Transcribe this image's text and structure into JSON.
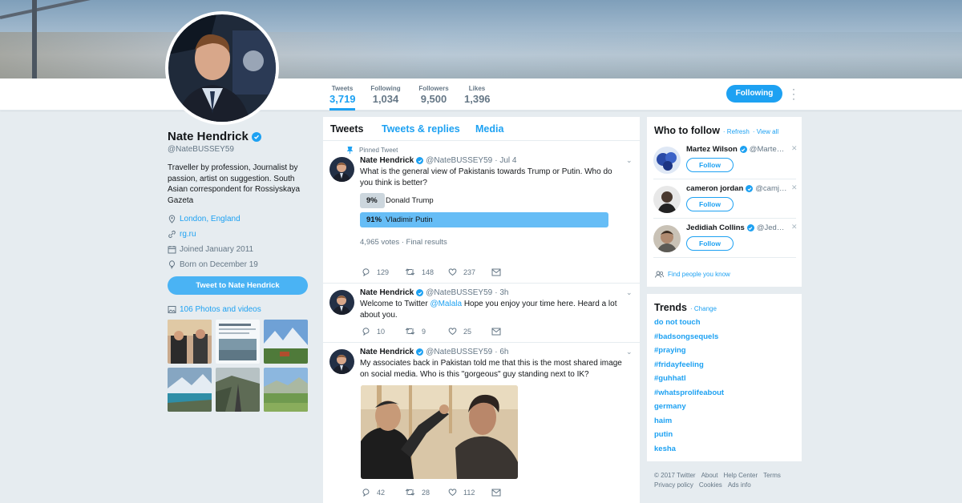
{
  "profile": {
    "name": "Nate Hendrick",
    "handle": "@NateBUSSEY59",
    "bio": "Traveller by profession, Journalist by passion, artist on suggestion. South Asian correspondent for Rossiyskaya Gazeta",
    "location": "London, England",
    "website": "rg.ru",
    "joined": "Joined January 2011",
    "born": "Born on December 19",
    "tweet_to_label": "Tweet to Nate Hendrick",
    "photos_label": "106 Photos and videos"
  },
  "stats": {
    "tweets_label": "Tweets",
    "tweets_value": "3,719",
    "following_label": "Following",
    "following_value": "1,034",
    "followers_label": "Followers",
    "followers_value": "9,500",
    "likes_label": "Likes",
    "likes_value": "1,396",
    "follow_button": "Following"
  },
  "tabs": {
    "tweets": "Tweets",
    "tweets_replies": "Tweets & replies",
    "media": "Media"
  },
  "tweets": [
    {
      "pinned_label": "Pinned Tweet",
      "name": "Nate Hendrick",
      "handle": "@NateBUSSEY59",
      "time": "· Jul 4",
      "text": "What is the general view of Pakistanis towards Trump or Putin. Who do you think is better?",
      "poll": {
        "options": [
          {
            "pct": "9%",
            "label": "Donald Trump",
            "share": 0.09
          },
          {
            "pct": "91%",
            "label": "Vladimir Putin",
            "share": 0.91
          }
        ],
        "meta": "4,965 votes · Final results"
      },
      "replies": "129",
      "retweets": "148",
      "likes": "237"
    },
    {
      "name": "Nate Hendrick",
      "handle": "@NateBUSSEY59",
      "time": "· 3h",
      "text_before": "Welcome to Twitter ",
      "mention": "@Malala",
      "text_after": " Hope you enjoy your time here. Heard a lot about you.",
      "replies": "10",
      "retweets": "9",
      "likes": "25"
    },
    {
      "name": "Nate Hendrick",
      "handle": "@NateBUSSEY59",
      "time": "· 6h",
      "text": "My associates back in Pakistan told me that this is the most shared image on social media. Who is this \"gorgeous\" guy standing next to IK?",
      "replies": "42",
      "retweets": "28",
      "likes": "112"
    }
  ],
  "who_to_follow": {
    "title": "Who to follow",
    "refresh": "· Refresh",
    "view_all": "· View all",
    "follow_label": "Follow",
    "users": [
      {
        "name": "Martez Wilson",
        "handle": "@Marte…"
      },
      {
        "name": "cameron jordan",
        "handle": "@camj…"
      },
      {
        "name": "Jedidiah Collins",
        "handle": "@Jed…"
      }
    ],
    "find_people": "Find people you know"
  },
  "trends": {
    "title": "Trends",
    "change": "· Change",
    "items": [
      "do not touch",
      "#badsongsequels",
      "#praying",
      "#fridayfeeling",
      "#guhhatl",
      "#whatsprolifeabout",
      "germany",
      "haim",
      "putin",
      "kesha"
    ]
  },
  "footer": {
    "items_line1": [
      "© 2017 Twitter",
      "About",
      "Help Center",
      "Terms"
    ],
    "items_line2": [
      "Privacy policy",
      "Cookies",
      "Ads info"
    ]
  },
  "colors": {
    "accent": "#1da1f2",
    "background": "#e6ecf0",
    "poll_winner": "#66bdf6",
    "poll_loser": "#ccd6dd"
  }
}
